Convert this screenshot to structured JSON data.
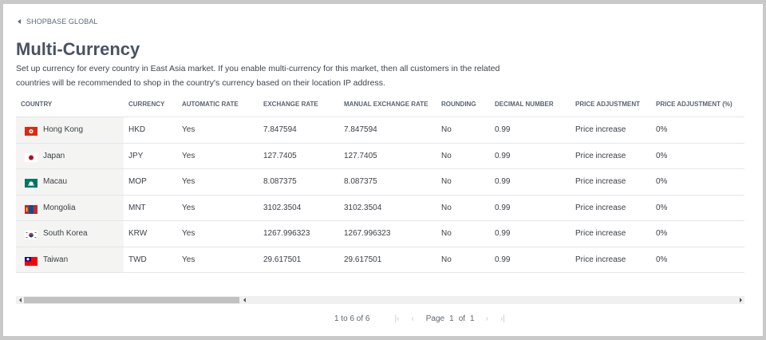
{
  "breadcrumb": {
    "label": "SHOPBASE GLOBAL"
  },
  "page": {
    "title": "Multi-Currency",
    "description": "Set up currency for every country in East Asia market. If you enable multi-currency for this market, then all customers in the related countries will be recommended to shop in the country's currency based on their location IP address."
  },
  "table": {
    "headers": {
      "country": "COUNTRY",
      "currency": "CURRENCY",
      "automatic_rate": "AUTOMATIC RATE",
      "exchange_rate": "EXCHANGE RATE",
      "manual_exchange_rate": "MANUAL EXCHANGE RATE",
      "rounding": "ROUNDING",
      "decimal_number": "DECIMAL NUMBER",
      "price_adjustment": "PRICE ADJUSTMENT",
      "price_adjustment_pct": "PRICE ADJUSTMENT (%)"
    },
    "rows": [
      {
        "country": "Hong Kong",
        "flag": "hong-kong-flag-icon",
        "currency": "HKD",
        "automatic_rate": "Yes",
        "exchange_rate": "7.847594",
        "manual_exchange_rate": "7.847594",
        "rounding": "No",
        "decimal_number": "0.99",
        "price_adjustment": "Price increase",
        "price_adjustment_pct": "0%"
      },
      {
        "country": "Japan",
        "flag": "japan-flag-icon",
        "currency": "JPY",
        "automatic_rate": "Yes",
        "exchange_rate": "127.7405",
        "manual_exchange_rate": "127.7405",
        "rounding": "No",
        "decimal_number": "0.99",
        "price_adjustment": "Price increase",
        "price_adjustment_pct": "0%"
      },
      {
        "country": "Macau",
        "flag": "macau-flag-icon",
        "currency": "MOP",
        "automatic_rate": "Yes",
        "exchange_rate": "8.087375",
        "manual_exchange_rate": "8.087375",
        "rounding": "No",
        "decimal_number": "0.99",
        "price_adjustment": "Price increase",
        "price_adjustment_pct": "0%"
      },
      {
        "country": "Mongolia",
        "flag": "mongolia-flag-icon",
        "currency": "MNT",
        "automatic_rate": "Yes",
        "exchange_rate": "3102.3504",
        "manual_exchange_rate": "3102.3504",
        "rounding": "No",
        "decimal_number": "0.99",
        "price_adjustment": "Price increase",
        "price_adjustment_pct": "0%"
      },
      {
        "country": "South Korea",
        "flag": "south-korea-flag-icon",
        "currency": "KRW",
        "automatic_rate": "Yes",
        "exchange_rate": "1267.996323",
        "manual_exchange_rate": "1267.996323",
        "rounding": "No",
        "decimal_number": "0.99",
        "price_adjustment": "Price increase",
        "price_adjustment_pct": "0%"
      },
      {
        "country": "Taiwan",
        "flag": "taiwan-flag-icon",
        "currency": "TWD",
        "automatic_rate": "Yes",
        "exchange_rate": "29.617501",
        "manual_exchange_rate": "29.617501",
        "rounding": "No",
        "decimal_number": "0.99",
        "price_adjustment": "Price increase",
        "price_adjustment_pct": "0%"
      }
    ]
  },
  "pagination": {
    "summary": "1 to 6 of 6",
    "page_label": "Page",
    "current_page": "1",
    "of_label": "of",
    "total_pages": "1",
    "first_icon": "first-page-icon",
    "prev_icon": "previous-page-icon",
    "next_icon": "next-page-icon",
    "last_icon": "last-page-icon"
  },
  "colors": {
    "title": "#4a5360",
    "pinned_column_bg": "#f4f5f3",
    "row_border": "#e3e6ea",
    "scroll_thumb": "#c1c1c1"
  }
}
